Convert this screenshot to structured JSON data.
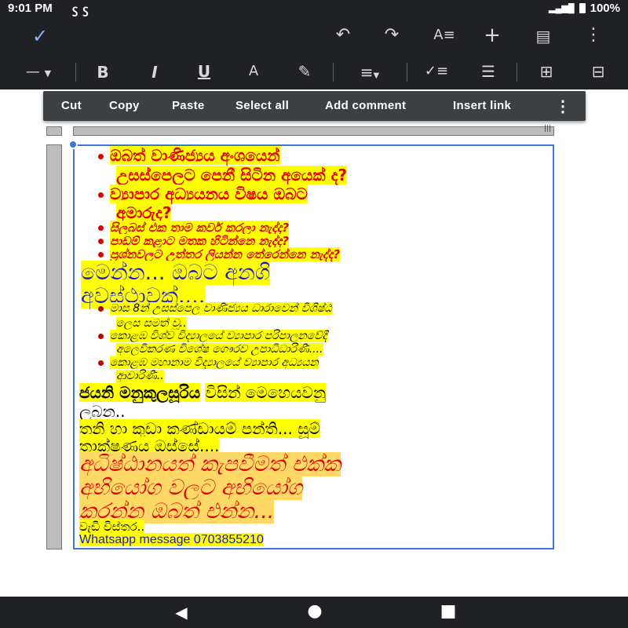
{
  "status_bar": {
    "time": "9:01 PM",
    "notifications": "ꚃ ꚃ",
    "battery": "100%"
  },
  "toolbar": {
    "icons": [
      "check-icon",
      "undo-icon",
      "redo-icon",
      "text-format-icon",
      "add-icon",
      "comment-icon",
      "more-vert-icon"
    ]
  },
  "format_bar": {
    "line_style": "—",
    "bold": "B",
    "italic": "I",
    "underline": "U",
    "text_color": "A"
  },
  "context_menu": {
    "items": [
      "Cut",
      "Copy",
      "Paste",
      "Select all",
      "Add comment",
      "Insert link"
    ]
  },
  "document": {
    "lines": [
      "ඔබත් වාණිජ්‍යය අංශයෙන්",
      "උසස්පෙලට පෙනී සිටින අයෙක් ද?",
      "ව්‍යාපාර අධ්‍යයනය විෂය ඔබට",
      "අමාරුද?",
      "සිලබස් එක තාම කවර් කරලා නැද්ද?",
      "පාඩම් කළාට මතක හිටින්නෙ නැද්ද?",
      "ප්‍රශ්නවලට උත්තර ලියන්න තේරෙන්නෙ නැද්ද?",
      "මෙන්න... ඔබට අනගි",
      "අවස්ථාවක්....",
      "මාස 8න් උසස්පෙල වාණිජ්‍යය ධාරාවෙන් විශිෂ්ඨ",
      "ලෙස සමත් වූ..",
      "කොළඹ විශ්ව විද්‍යාලයේ ව්‍යාපාර පරිපාලනවේදී",
      "අලෙවිකරණ විශේෂ ගෞරව උපාධිධාරිණී....",
      "කොළඹ මහානාම විද්‍යාලයේ ව්‍යාපාර අධ්‍යයන",
      "ආචාරිණී..",
      "ජයනි මනුකුලසූරිය",
      "විසින් මෙහෙයවනු",
      "ලබන..",
      "තනි හා කුඩා කණ්ඩායම් පන්ති... සූම්",
      "තාක්ෂණය ඔස්සේ....",
      "අධිෂ්ඨානයත් කැපවීමත් එක්ක",
      "අභියෝග වලට අභියෝග",
      "කරන්න ඔබත් එන්න...",
      "වැඩි විස්තර..",
      "Whatsapp message 0703855210"
    ]
  },
  "colors": {
    "highlight_yellow": "#ffff00",
    "highlight_orange": "#ffd966",
    "text_red": "#e00000",
    "text_blue": "#1a1ad0",
    "selection_blue": "#3d78d8"
  }
}
